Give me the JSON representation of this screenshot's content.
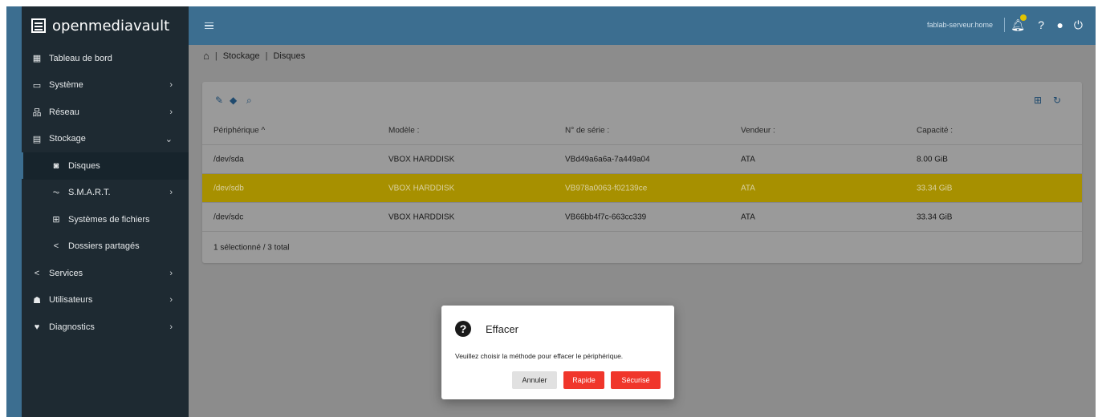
{
  "app": {
    "brand": "openmediavault"
  },
  "sidebar": {
    "items": [
      {
        "label": "Tableau de bord",
        "icon": "dashboard-icon"
      },
      {
        "label": "Système",
        "icon": "laptop-icon",
        "chevron": true
      },
      {
        "label": "Réseau",
        "icon": "network-icon",
        "chevron": true
      },
      {
        "label": "Stockage",
        "icon": "storage-icon",
        "chevron": true,
        "expanded": true
      },
      {
        "label": "Disques",
        "icon": "disk-icon",
        "sub": true,
        "active": true
      },
      {
        "label": "S.M.A.R.T.",
        "icon": "pulse-icon",
        "sub": true,
        "chevron": true
      },
      {
        "label": "Systèmes de fichiers",
        "icon": "filesystem-icon",
        "sub": true
      },
      {
        "label": "Dossiers partagés",
        "icon": "share-icon",
        "sub": true
      },
      {
        "label": "Services",
        "icon": "share-icon",
        "chevron": true
      },
      {
        "label": "Utilisateurs",
        "icon": "users-icon",
        "chevron": true
      },
      {
        "label": "Diagnostics",
        "icon": "heart-pulse-icon",
        "chevron": true
      }
    ]
  },
  "header": {
    "hostname": "fablab-serveur.home",
    "badge_color": "#e2c400"
  },
  "breadcrumb": {
    "items": [
      "Stockage",
      "Disques"
    ]
  },
  "table": {
    "columns": [
      "Périphérique ^",
      "Modèle :",
      "N° de série :",
      "Vendeur :",
      "Capacité :"
    ],
    "rows": [
      {
        "device": "/dev/sda",
        "model": "VBOX HARDDISK",
        "serial": "VBd49a6a6a-7a449a04",
        "vendor": "ATA",
        "capacity": "8.00 GiB",
        "selected": false
      },
      {
        "device": "/dev/sdb",
        "model": "VBOX HARDDISK",
        "serial": "VB978a0063-f02139ce",
        "vendor": "ATA",
        "capacity": "33.34 GiB",
        "selected": true
      },
      {
        "device": "/dev/sdc",
        "model": "VBOX HARDDISK",
        "serial": "VB66bb4f7c-663cc339",
        "vendor": "ATA",
        "capacity": "33.34 GiB",
        "selected": false
      }
    ],
    "footer": "1 sélectionné / 3 total",
    "selected_color": "#a79000"
  },
  "dialog": {
    "title": "Effacer",
    "message": "Veuillez choisir la méthode pour effacer le périphérique.",
    "cancel_label": "Annuler",
    "quick_label": "Rapide",
    "secure_label": "Sécurisé",
    "danger_color": "#f0362b"
  }
}
